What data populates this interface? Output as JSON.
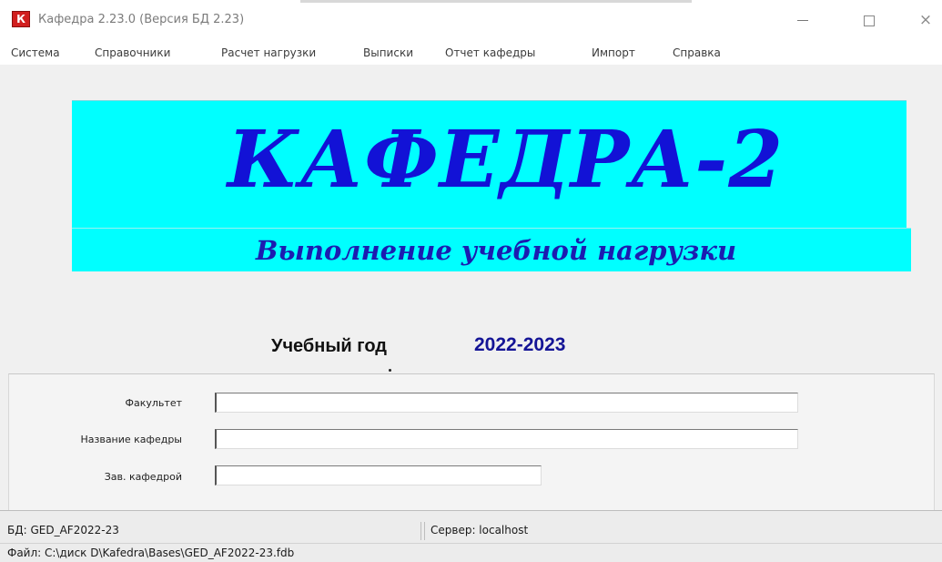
{
  "window": {
    "title": "Кафедра  2.23.0  (Версия БД  2.23)",
    "icon_glyph": "К",
    "minimize_label": "",
    "maximize_label": "",
    "close_label": "×"
  },
  "menu": [
    {
      "label": "Система"
    },
    {
      "label": "Справочники"
    },
    {
      "label": "Расчет нагрузки"
    },
    {
      "label": "Выписки"
    },
    {
      "label": "Отчет кафедры"
    },
    {
      "label": "Импорт"
    },
    {
      "label": "Справка"
    }
  ],
  "banner": {
    "title": "КАФЕДРА-2",
    "subtitle": "Выполнение учебной нагрузки"
  },
  "academic_year": {
    "label": "Учебный год",
    "value": "2022-2023"
  },
  "form": {
    "faculty": {
      "label": "Факультет",
      "value": ""
    },
    "department_name": {
      "label": "Название кафедры",
      "value": ""
    },
    "department_head": {
      "label": "Зав. кафедрой",
      "value": ""
    }
  },
  "status": {
    "db": "БД: GED_AF2022-23",
    "server": "Сервер: localhost",
    "file": "Файл: C:\\диск D\\Kafedra\\Bases\\GED_AF2022-23.fdb"
  },
  "colors": {
    "banner_bg": "#00ffff",
    "banner_text": "#1212d6",
    "year_value": "#141496",
    "app_icon": "#d11f1f"
  },
  "icons": {
    "app": "kafedra-app-icon",
    "minimize": "minimize-icon",
    "maximize": "maximize-icon",
    "close": "close-icon"
  }
}
